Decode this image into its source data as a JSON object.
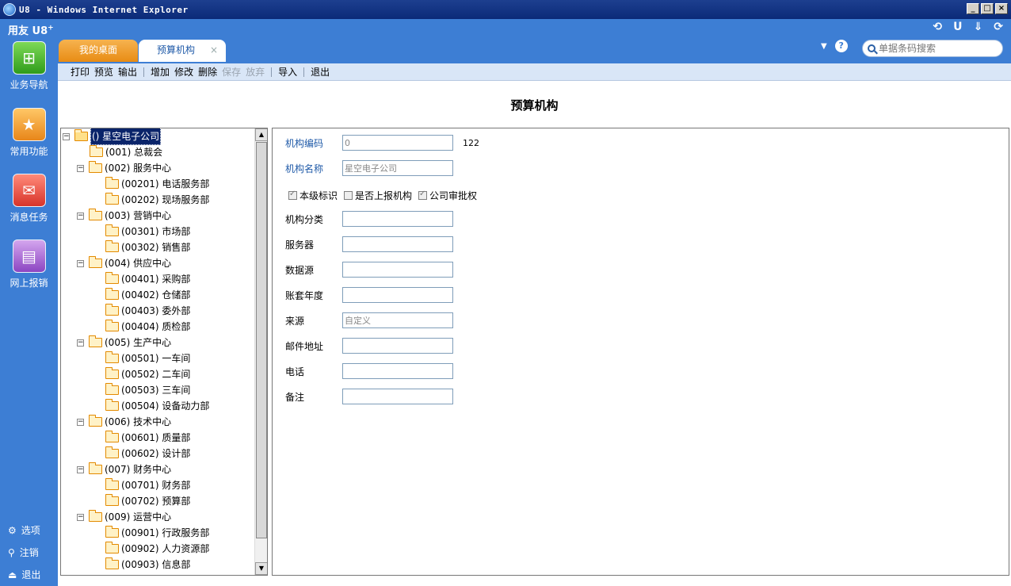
{
  "window": {
    "title": "U8 - Windows Internet Explorer",
    "buttons": [
      "_",
      "□",
      "×"
    ]
  },
  "header": {
    "brand": "用友 U8",
    "brand_sup": "+",
    "right_icons": [
      "⟲",
      "U",
      "⇓",
      "⟳"
    ],
    "tabs": {
      "home": "我的桌面",
      "active": "预算机构",
      "close": "×"
    },
    "help": "?",
    "caret": "▼",
    "search_placeholder": "单据条码搜索"
  },
  "leftnav": {
    "items": [
      {
        "label": "业务导航",
        "icon": "⊞"
      },
      {
        "label": "常用功能",
        "icon": "★"
      },
      {
        "label": "消息任务",
        "icon": "✉"
      },
      {
        "label": "网上报销",
        "icon": "▤"
      }
    ],
    "bottom": [
      {
        "label": "选项",
        "icon": "⚙"
      },
      {
        "label": "注销",
        "icon": "⚲"
      },
      {
        "label": "退出",
        "icon": "⏏"
      }
    ]
  },
  "toolbar": {
    "print": "打印",
    "preview": "预览",
    "export": "输出",
    "add": "增加",
    "edit": "修改",
    "delete": "删除",
    "save": "保存",
    "discard": "放弃",
    "import": "导入",
    "exit": "退出"
  },
  "page_title": "预算机构",
  "tree": {
    "root": "() 星空电子公司",
    "nodes": [
      "(001) 总裁会",
      "(002) 服务中心",
      "(00201) 电话服务部",
      "(00202) 现场服务部",
      "(003) 营销中心",
      "(00301) 市场部",
      "(00302) 销售部",
      "(004) 供应中心",
      "(00401) 采购部",
      "(00402) 仓储部",
      "(00403) 委外部",
      "(00404) 质检部",
      "(005) 生产中心",
      "(00501) 一车间",
      "(00502) 二车间",
      "(00503) 三车间",
      "(00504) 设备动力部",
      "(006) 技术中心",
      "(00601) 质量部",
      "(00602) 设计部",
      "(007) 财务中心",
      "(00701) 财务部",
      "(00702) 预算部",
      "(009) 运营中心",
      "(00901) 行政服务部",
      "(00902) 人力资源部",
      "(00903) 信息部"
    ]
  },
  "form": {
    "code_label": "机构编码",
    "code_value": "0",
    "code_extra": "122",
    "name_label": "机构名称",
    "name_value": "星空电子公司",
    "cb_level": "本级标识",
    "cb_report": "是否上报机构",
    "cb_approve": "公司审批权",
    "category_label": "机构分类",
    "server_label": "服务器",
    "datasource_label": "数据源",
    "year_label": "账套年度",
    "source_label": "来源",
    "source_value": "自定义",
    "email_label": "邮件地址",
    "phone_label": "电话",
    "remark_label": "备注"
  }
}
